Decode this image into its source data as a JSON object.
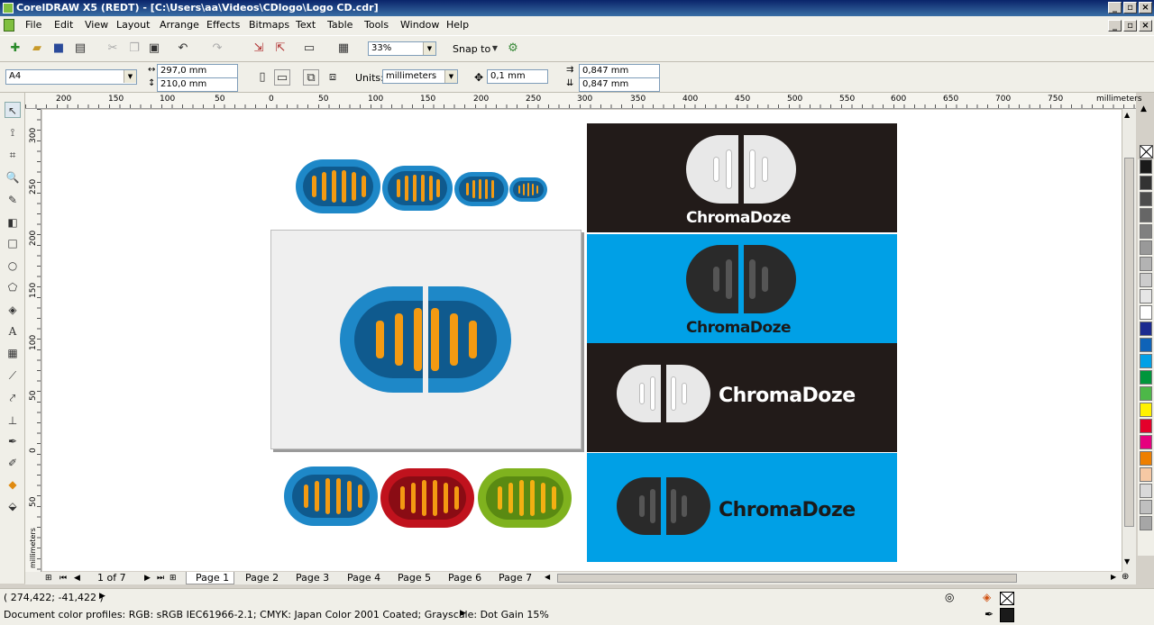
{
  "window": {
    "title": "CorelDRAW X5 (REDT) - [C:\\Users\\aa\\Videos\\CDlogo\\Logo CD.cdr]",
    "min": "_",
    "max": "▫",
    "close": "×"
  },
  "menu": [
    "File",
    "Edit",
    "View",
    "Layout",
    "Arrange",
    "Effects",
    "Bitmaps",
    "Text",
    "Table",
    "Tools",
    "Window",
    "Help"
  ],
  "toolbar1": {
    "zoom": "33%",
    "snap_label": "Snap to"
  },
  "toolbar2": {
    "page_size": "A4",
    "width": "297,0 mm",
    "height": "210,0 mm",
    "units_label": "Units:",
    "units": "millimeters",
    "nudge": "0,1 mm",
    "dup_x": "0,847 mm",
    "dup_y": "0,847 mm"
  },
  "hruler": {
    "labels": [
      "200",
      "150",
      "100",
      "50",
      "0",
      "50",
      "100",
      "150",
      "200",
      "250",
      "300",
      "350",
      "400",
      "450",
      "500",
      "550",
      "600",
      "650",
      "700",
      "750"
    ],
    "unit": "millimeters"
  },
  "vruler": {
    "labels": [
      "300",
      "250",
      "200",
      "150",
      "100",
      "50",
      "0",
      "50"
    ],
    "unit": "millimeters"
  },
  "pages": {
    "counter": "1 of 7",
    "tabs": [
      "Page 1",
      "Page 2",
      "Page 3",
      "Page 4",
      "Page 5",
      "Page 6",
      "Page 7"
    ],
    "active": "Page 1"
  },
  "artwork": {
    "brand_name": "ChromaDoze",
    "colors": {
      "blue": "#1e88c8",
      "dark_blue": "#0f5a8e",
      "orange": "#f39a12",
      "red": "#c0121d",
      "green": "#7fb21e",
      "dark_panel": "#221b19",
      "cyan_panel": "#00a0e6",
      "white_logo": "#e8e8e8",
      "dark_logo": "#3a3a3a"
    }
  },
  "status": {
    "coords": "( 274,422; -41,422 )",
    "profiles": "Document color profiles: RGB: sRGB IEC61966-2.1; CMYK: Japan Color 2001 Coated; Grayscale: Dot Gain 15%"
  },
  "palette": [
    "#1a1a1a",
    "#333333",
    "#4d4d4d",
    "#666666",
    "#808080",
    "#999999",
    "#b3b3b3",
    "#cccccc",
    "#e6e6e6",
    "#ffffff",
    "#1c2b8f",
    "#0f63b8",
    "#00a0e6",
    "#00963c",
    "#4db848",
    "#fff100",
    "#e4002b",
    "#e6007e",
    "#ee7f00",
    "#f6c9a4",
    "#d9d9d9",
    "#bfbfbf",
    "#a6a6a6"
  ]
}
